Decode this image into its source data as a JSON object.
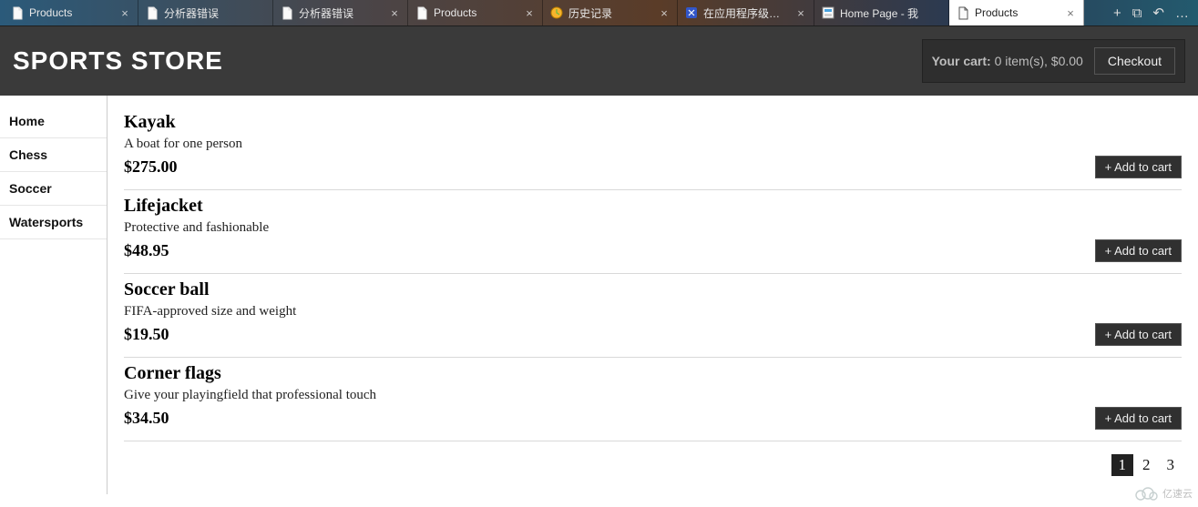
{
  "browser": {
    "tabs": [
      {
        "title": "Products",
        "icon": "page",
        "closeable": true,
        "active": false
      },
      {
        "title": "分析器错误",
        "icon": "page",
        "closeable": false,
        "active": false
      },
      {
        "title": "分析器错误",
        "icon": "page",
        "closeable": true,
        "active": false
      },
      {
        "title": "Products",
        "icon": "page",
        "closeable": true,
        "active": false
      },
      {
        "title": "历史记录",
        "icon": "clock",
        "closeable": true,
        "active": false
      },
      {
        "title": "在应用程序级别之",
        "icon": "app",
        "closeable": true,
        "active": false
      },
      {
        "title": "Home Page - 我",
        "icon": "home",
        "closeable": false,
        "active": false
      },
      {
        "title": "Products",
        "icon": "page",
        "closeable": true,
        "active": true
      }
    ],
    "tools": {
      "newtab": "+",
      "panel": "⧉",
      "undo": "↶",
      "more": "…"
    }
  },
  "header": {
    "brand": "SPORTS STORE",
    "cart_label": "Your cart:",
    "cart_value": "0 item(s), $0.00",
    "checkout": "Checkout"
  },
  "sidebar": {
    "items": [
      {
        "label": "Home"
      },
      {
        "label": "Chess"
      },
      {
        "label": "Soccer"
      },
      {
        "label": "Watersports"
      }
    ]
  },
  "add_label": "+ Add to cart",
  "products": [
    {
      "name": "Kayak",
      "desc": "A boat for one person",
      "price": "$275.00"
    },
    {
      "name": "Lifejacket",
      "desc": "Protective and fashionable",
      "price": "$48.95"
    },
    {
      "name": "Soccer ball",
      "desc": "FIFA-approved size and weight",
      "price": "$19.50"
    },
    {
      "name": "Corner flags",
      "desc": "Give your playingfield that professional touch",
      "price": "$34.50"
    }
  ],
  "pager": {
    "pages": [
      "1",
      "2",
      "3"
    ],
    "current": 0
  },
  "watermark": "亿速云"
}
